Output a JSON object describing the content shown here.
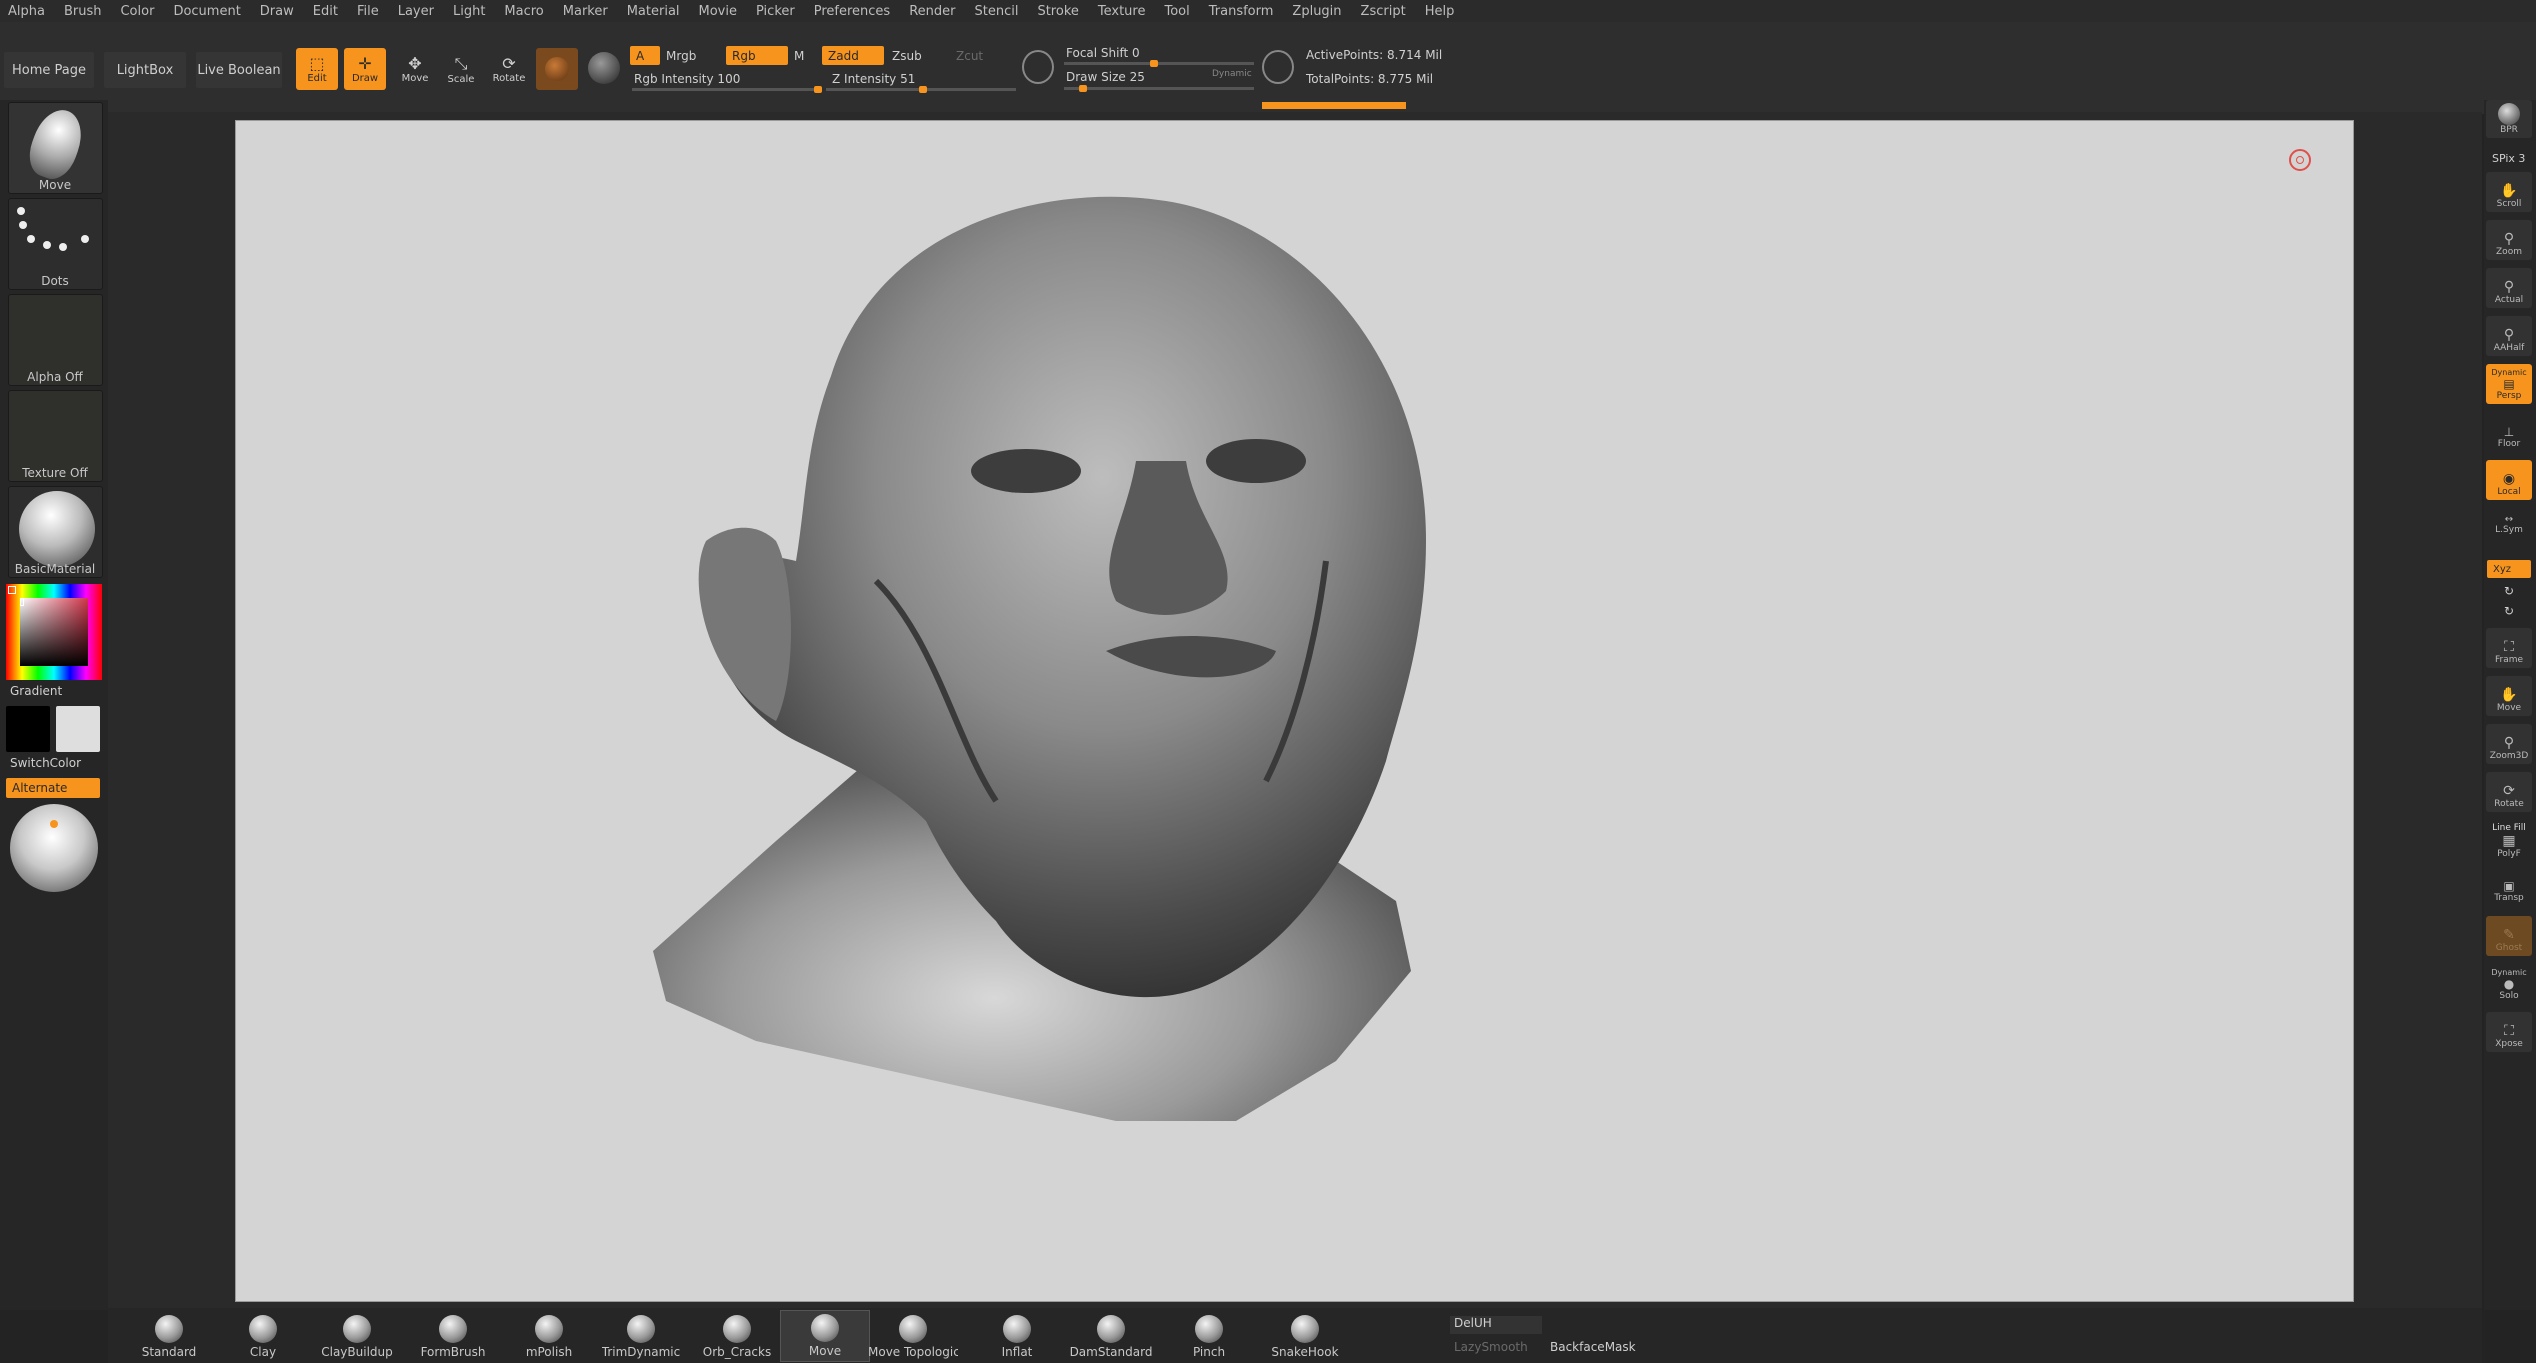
{
  "menu": [
    "Alpha",
    "Brush",
    "Color",
    "Document",
    "Draw",
    "Edit",
    "File",
    "Layer",
    "Light",
    "Macro",
    "Marker",
    "Material",
    "Movie",
    "Picker",
    "Preferences",
    "Render",
    "Stencil",
    "Stroke",
    "Texture",
    "Tool",
    "Transform",
    "Zplugin",
    "Zscript",
    "Help"
  ],
  "top": {
    "home_page": "Home Page",
    "lightbox": "LightBox",
    "live_boolean": "Live Boolean",
    "edit": "Edit",
    "draw": "Draw",
    "move": "Move",
    "scale": "Scale",
    "rotate": "Rotate",
    "a": "A",
    "mrgb": "Mrgb",
    "rgb": "Rgb",
    "m": "M",
    "zadd": "Zadd",
    "zsub": "Zsub",
    "zcut": "Zcut",
    "rgb_intensity": "Rgb Intensity 100",
    "z_intensity": "Z Intensity 51",
    "focal_shift": "Focal Shift 0",
    "draw_size": "Draw Size 25",
    "dynamic": "Dynamic",
    "active_points": "ActivePoints: 8.714 Mil",
    "total_points": "TotalPoints: 8.775 Mil",
    "rgb_intensity_value": 100,
    "z_intensity_value": 51,
    "draw_size_value": 25
  },
  "left": {
    "brush": "Move",
    "stroke": "Dots",
    "alpha": "Alpha Off",
    "texture": "Texture Off",
    "material": "BasicMaterial",
    "gradient": "Gradient",
    "switch_color": "SwitchColor",
    "alternate": "Alternate"
  },
  "right": {
    "bpr": "BPR",
    "spix": "SPix 3",
    "scroll": "Scroll",
    "zoom": "Zoom",
    "actual": "Actual",
    "aahalf": "AAHalf",
    "persp": "Persp",
    "dynamic": "Dynamic",
    "floor": "Floor",
    "local": "Local",
    "lsym": "L.Sym",
    "xyz": "Xyz",
    "frame": "Frame",
    "move": "Move",
    "zoom3d": "Zoom3D",
    "rotate": "Rotate",
    "line_fill": "Line Fill",
    "polyf": "PolyF",
    "transp": "Transp",
    "ghost": "Ghost",
    "dynamic2": "Dynamic",
    "solo": "Solo",
    "xpose": "Xpose"
  },
  "brushes": [
    "Standard",
    "Clay",
    "ClayBuildup",
    "FormBrush",
    "mPolish",
    "TrimDynamic",
    "Orb_Cracks",
    "Move",
    "Move Topologica",
    "Inflat",
    "DamStandard",
    "Pinch",
    "SnakeHook"
  ],
  "bottom": {
    "deluh": "DelUH",
    "lazysmooth": "LazySmooth",
    "backface": "BackfaceMask"
  },
  "colors": {
    "accent": "#f7941d",
    "canvas": "#d4d4d4"
  }
}
